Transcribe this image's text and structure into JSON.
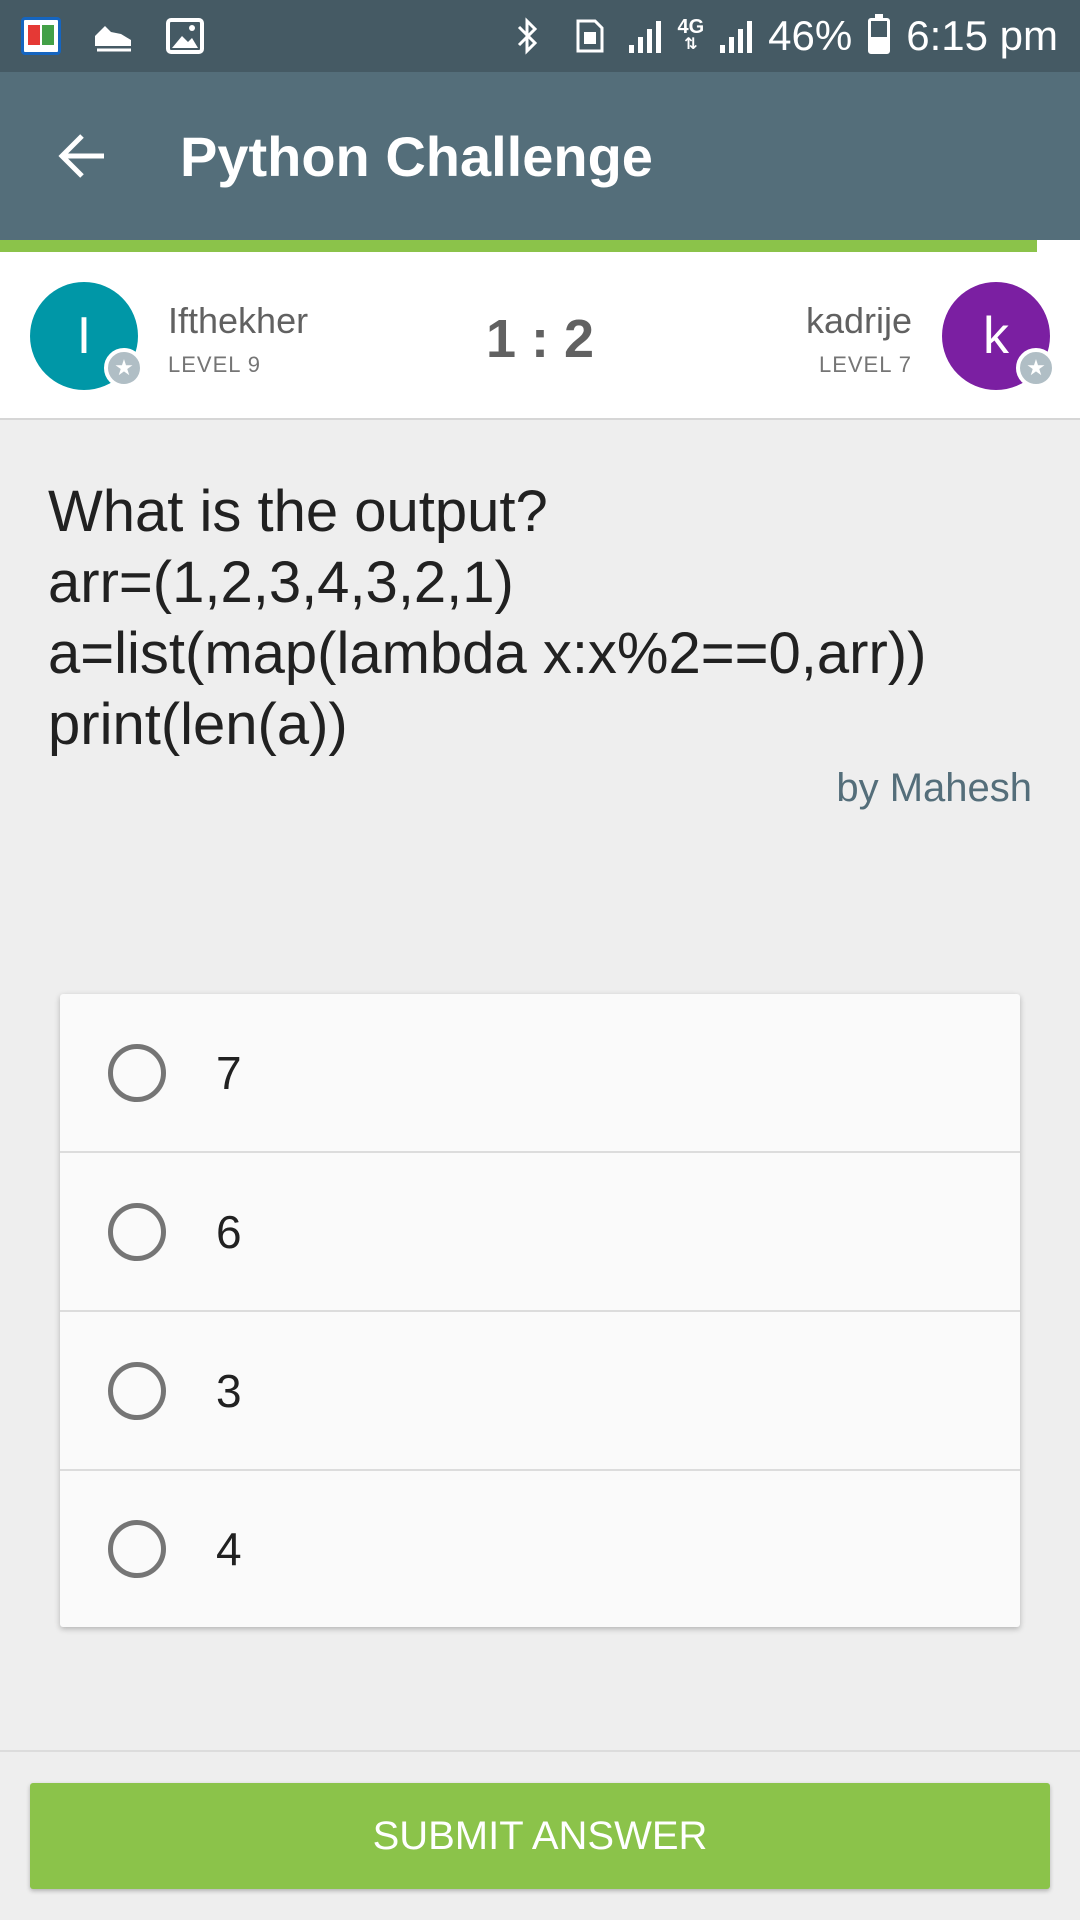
{
  "status_bar": {
    "icons_left": [
      "dictionary-app-icon",
      "shoe-icon",
      "image-icon"
    ],
    "icons_right": [
      "bluetooth-icon",
      "sim-icon",
      "signal-icon",
      "4g-icon",
      "signal-icon",
      "battery-icon"
    ],
    "network_label": "4G",
    "battery": "46%",
    "time": "6:15 pm"
  },
  "app_bar": {
    "title": "Python Challenge",
    "back_icon": "arrow-back-icon",
    "color": "#546e7a"
  },
  "progress": {
    "fraction": 0.96,
    "color": "#8bc34a"
  },
  "match": {
    "player1": {
      "initial": "I",
      "name": "Ifthekher",
      "level": "LEVEL 9",
      "color": "#0097a7"
    },
    "player2": {
      "initial": "k",
      "name": "kadrije",
      "level": "LEVEL 7",
      "color": "#7b1fa2"
    },
    "score": "1 : 2"
  },
  "question": {
    "lines": [
      "What is the output?",
      "arr=(1,2,3,4,3,2,1)",
      "a=list(map(lambda x:x%2==0,arr))",
      "print(len(a))"
    ],
    "author": "by Mahesh"
  },
  "options": [
    {
      "label": "7"
    },
    {
      "label": "6"
    },
    {
      "label": "3"
    },
    {
      "label": "4"
    }
  ],
  "submit_label": "SUBMIT ANSWER"
}
